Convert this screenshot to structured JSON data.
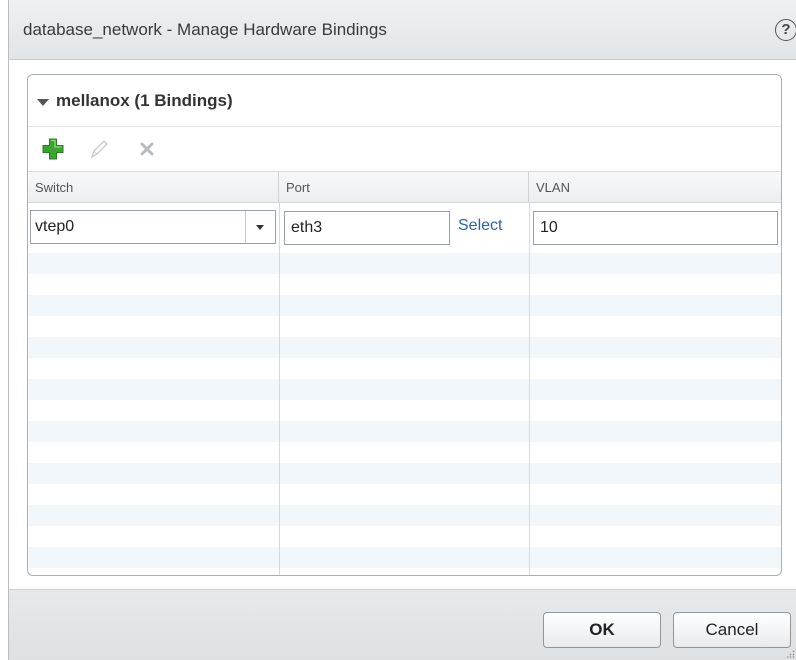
{
  "dialog": {
    "title": "database_network - Manage Hardware Bindings",
    "help_label": "?"
  },
  "group": {
    "title": "mellanox (1 Bindings)",
    "icon": "triangle-down-icon"
  },
  "toolbar": {
    "add_icon": "plus-icon",
    "edit_icon": "pencil-icon",
    "delete_icon": "close-icon"
  },
  "columns": [
    "Switch",
    "Port",
    "VLAN"
  ],
  "rows": [
    {
      "switch": "vtep0",
      "port": "eth3",
      "port_action": "Select",
      "vlan": "10"
    }
  ],
  "footer": {
    "ok_label": "OK",
    "cancel_label": "Cancel"
  },
  "colors": {
    "accent_green": "#3aa52e",
    "link_blue": "#2a63b5",
    "stripe": "#f2f7fb"
  }
}
